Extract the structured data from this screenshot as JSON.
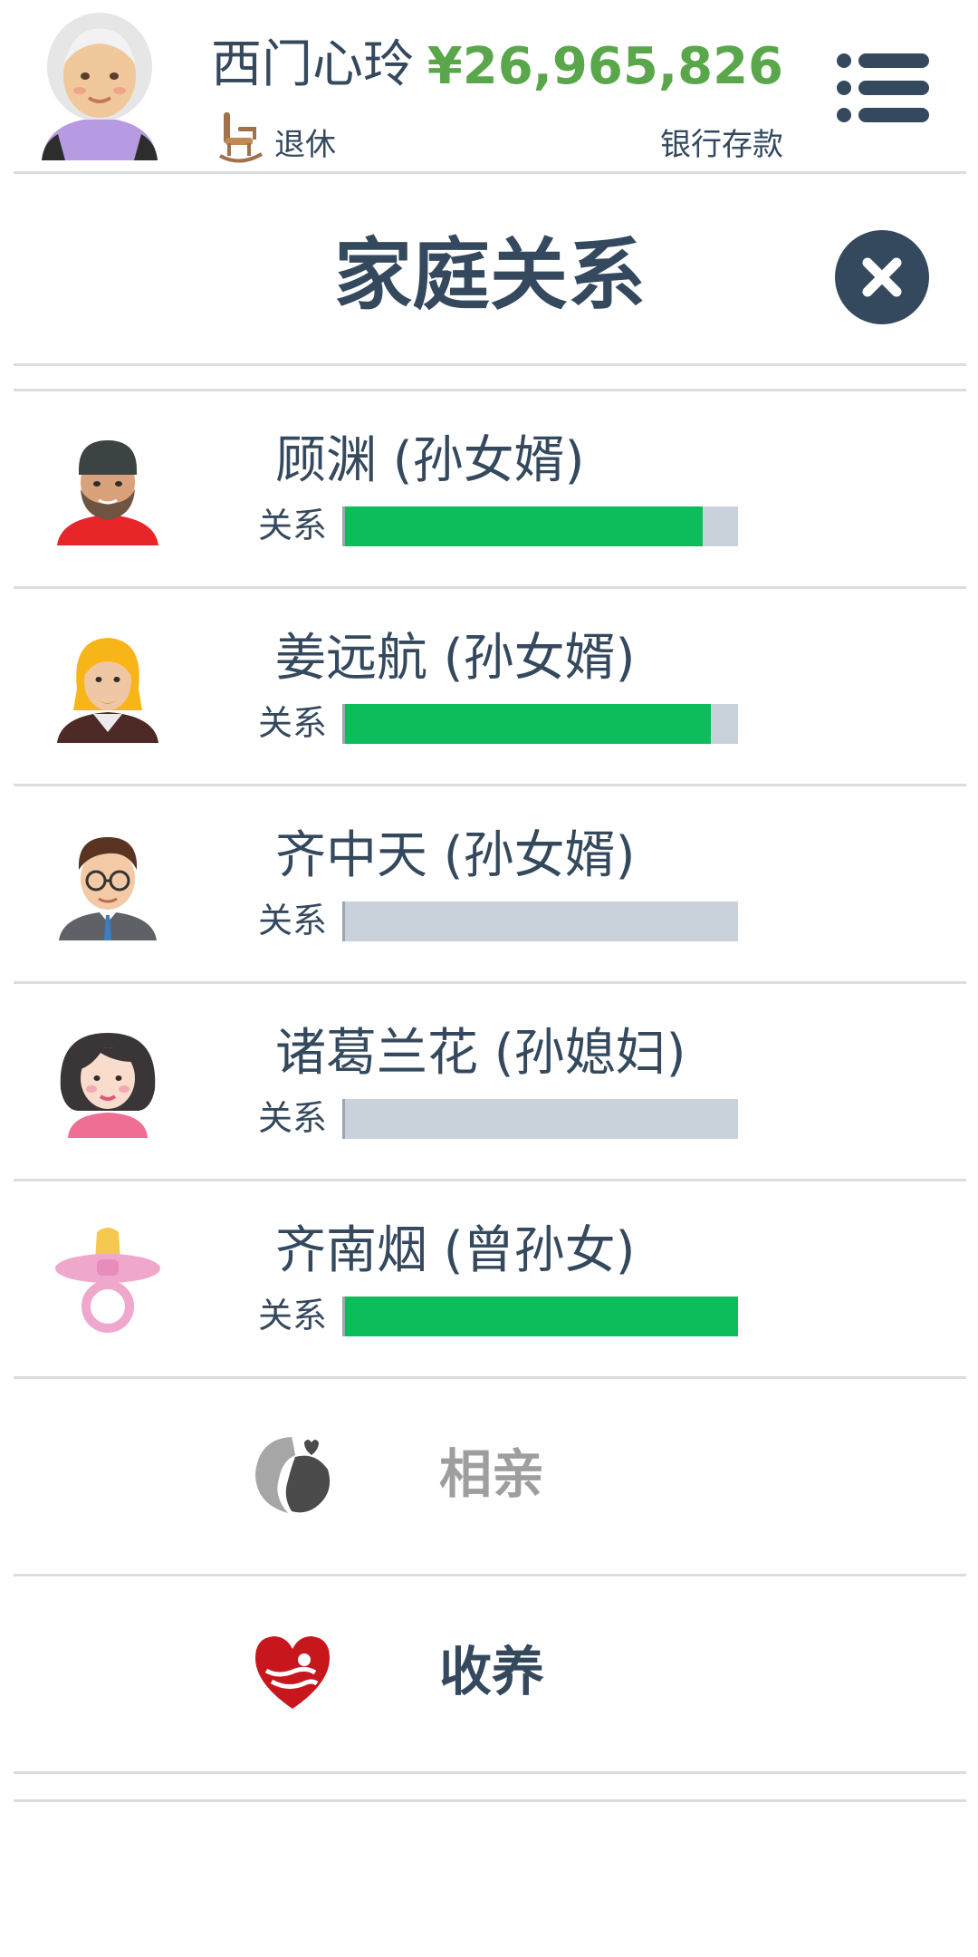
{
  "header": {
    "player_name": "西门心玲",
    "status": "退休",
    "money": "¥26,965,826",
    "money_label": "银行存款"
  },
  "page": {
    "title": "家庭关系"
  },
  "relationship_label": "关系",
  "relations": [
    {
      "name": "",
      "relationship": 0.86,
      "icon": "yellow-person-avatar-icon"
    },
    {
      "name": "顾渊 (孙女婿)",
      "relationship": 0.91,
      "icon": "bearded-man-beanie-avatar-icon"
    },
    {
      "name": "姜远航 (孙女婿)",
      "relationship": 0.93,
      "icon": "blond-bearded-man-avatar-icon"
    },
    {
      "name": "齐中天 (孙女婿)",
      "relationship": 0.0,
      "icon": "man-with-glasses-avatar-icon"
    },
    {
      "name": "诸葛兰花 (孙媳妇)",
      "relationship": 0.0,
      "icon": "woman-avatar-icon"
    },
    {
      "name": "齐南烟 (曾孙女)",
      "relationship": 1.0,
      "icon": "pacifier-icon"
    }
  ],
  "actions": [
    {
      "label": "相亲",
      "icon": "dating-icon",
      "enabled": false
    },
    {
      "label": "收养",
      "icon": "adoption-heart-icon",
      "enabled": true
    }
  ],
  "colors": {
    "text": "#34495e",
    "money": "#5aa64b",
    "bar_fill": "#0dbd5b",
    "bar_track": "#c9d1da",
    "disabled": "#9e9e9e",
    "adoption_red": "#c8161d"
  }
}
